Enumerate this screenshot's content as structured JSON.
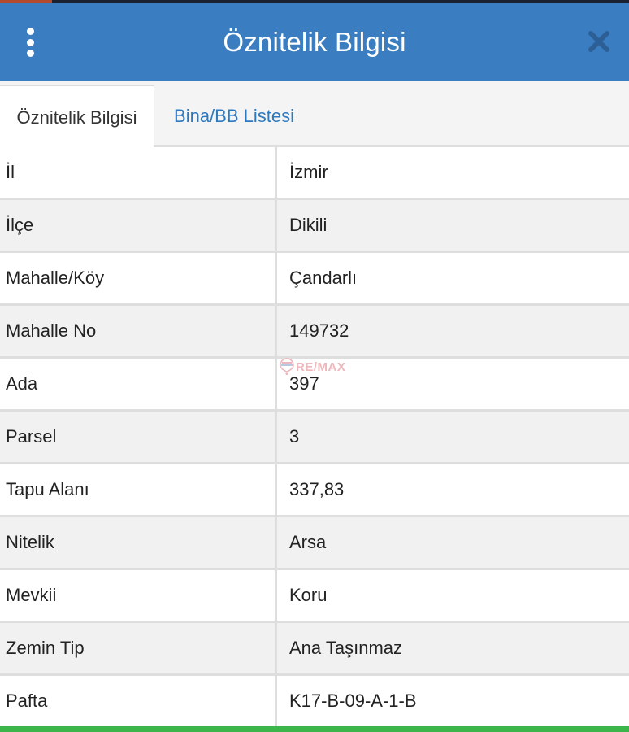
{
  "header": {
    "title": "Öznitelik Bilgisi",
    "menu_icon": "more-vertical-icon",
    "close_icon": "close-icon",
    "background_color": "#3a7dc0"
  },
  "tabs": [
    {
      "label": "Öznitelik Bilgisi",
      "active": true
    },
    {
      "label": "Bina/BB Listesi",
      "active": false
    }
  ],
  "rows": [
    {
      "label": "İl",
      "value": "İzmir"
    },
    {
      "label": "İlçe",
      "value": "Dikili"
    },
    {
      "label": "Mahalle/Köy",
      "value": "Çandarlı"
    },
    {
      "label": "Mahalle No",
      "value": "149732"
    },
    {
      "label": "Ada",
      "value": "397"
    },
    {
      "label": "Parsel",
      "value": "3"
    },
    {
      "label": "Tapu Alanı",
      "value": "337,83"
    },
    {
      "label": "Nitelik",
      "value": "Arsa"
    },
    {
      "label": "Mevkii",
      "value": "Koru"
    },
    {
      "label": "Zemin Tip",
      "value": "Ana Taşınmaz"
    },
    {
      "label": "Pafta",
      "value": "K17-B-09-A-1-B"
    }
  ],
  "watermark": {
    "text": "RE/MAX",
    "icon": "remax-balloon-icon"
  },
  "colors": {
    "accent_link": "#2e79bd",
    "bottom_bar": "#3cb54a"
  }
}
